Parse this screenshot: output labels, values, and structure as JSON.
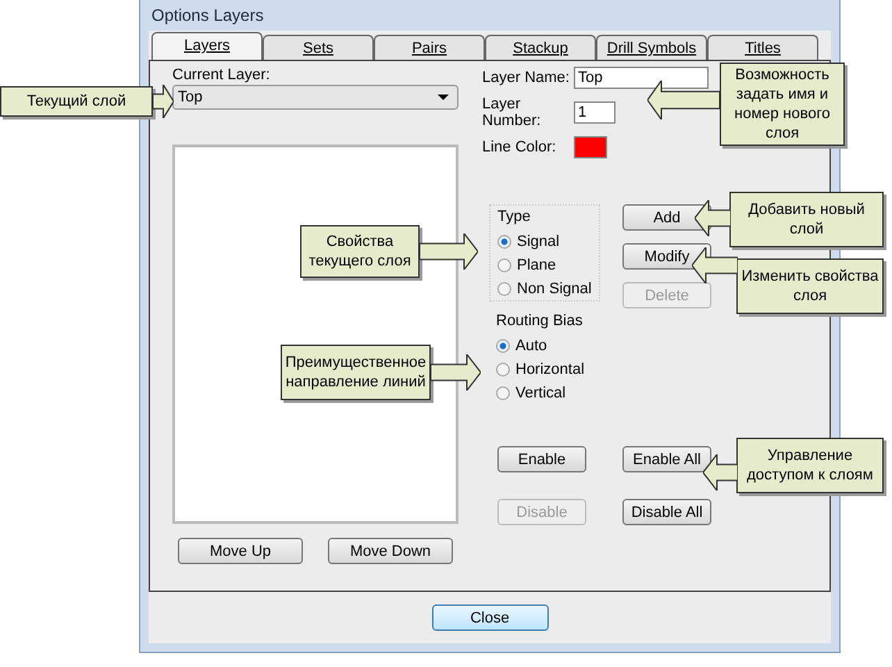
{
  "window": {
    "title": "Options Layers"
  },
  "tabs": [
    {
      "label": "Layers",
      "selected": true
    },
    {
      "label": "Sets",
      "selected": false
    },
    {
      "label": "Pairs",
      "selected": false
    },
    {
      "label": "Stackup",
      "selected": false
    },
    {
      "label": "Drill Symbols",
      "selected": false
    },
    {
      "label": "Titles",
      "selected": false
    }
  ],
  "current_layer": {
    "label": "Current Layer:",
    "value": "Top"
  },
  "layer_name": {
    "label": "Layer Name:",
    "value": "Top"
  },
  "layer_number": {
    "label": "Layer Number:",
    "value": "1"
  },
  "line_color": {
    "label": "Line Color:",
    "color": "#ff0000"
  },
  "type_group": {
    "title": "Type",
    "options": [
      {
        "label": "Signal",
        "selected": true
      },
      {
        "label": "Plane",
        "selected": false
      },
      {
        "label": "Non Signal",
        "selected": false
      }
    ]
  },
  "routing_bias": {
    "title": "Routing Bias",
    "options": [
      {
        "label": "Auto",
        "selected": true
      },
      {
        "label": "Horizontal",
        "selected": false
      },
      {
        "label": "Vertical",
        "selected": false
      }
    ]
  },
  "layer_buttons": [
    {
      "label": "Add",
      "disabled": false
    },
    {
      "label": "Modify",
      "disabled": false
    },
    {
      "label": "Delete",
      "disabled": true
    }
  ],
  "access_buttons": [
    {
      "label": "Enable",
      "disabled": false
    },
    {
      "label": "Enable All",
      "disabled": false
    },
    {
      "label": "Disable",
      "disabled": true
    },
    {
      "label": "Disable All",
      "disabled": false
    }
  ],
  "move_buttons": [
    {
      "label": "Move Up"
    },
    {
      "label": "Move Down"
    }
  ],
  "close_button": {
    "label": "Close"
  },
  "callouts": [
    {
      "text": "Текущий слой",
      "kind": "right"
    },
    {
      "text": "Возможность задать имя и номер нового слоя",
      "kind": "left"
    },
    {
      "text": "Свойства текущего слоя",
      "kind": "right"
    },
    {
      "text": "Преимущественное направление линий",
      "kind": "right"
    },
    {
      "text": "Добавить новый слой",
      "kind": "left"
    },
    {
      "text": "Изменить свойства слоя",
      "kind": "left"
    },
    {
      "text": "Управление доступом к слоям",
      "kind": "left"
    }
  ]
}
